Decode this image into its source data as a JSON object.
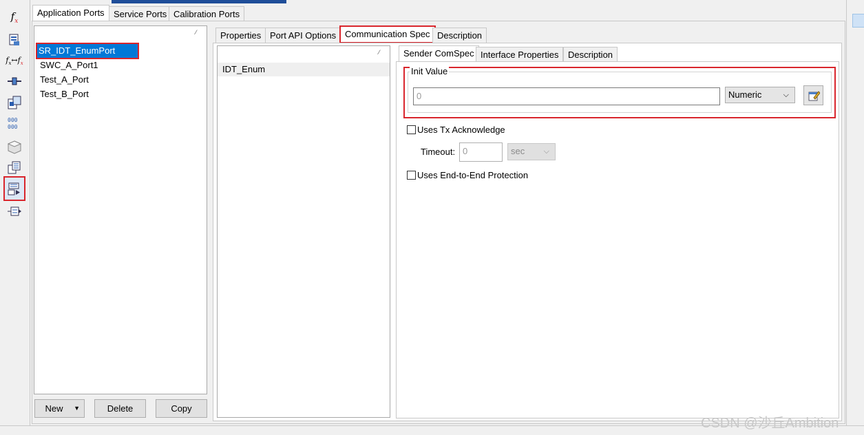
{
  "outer_tabs": [
    "Application Ports",
    "Service Ports",
    "Calibration Ports"
  ],
  "port_list": {
    "sort_mark": "⁄",
    "items": [
      "SR_IDT_EnumPort",
      "SWC_A_Port1",
      "Test_A_Port",
      "Test_B_Port"
    ],
    "selected_index": 0
  },
  "port_buttons": {
    "new": "New",
    "delete": "Delete",
    "copy": "Copy"
  },
  "detail_tabs": [
    "Properties",
    "Port API Options",
    "Communication Spec",
    "Description"
  ],
  "element_list": {
    "sort_mark": "⁄",
    "items": [
      "IDT_Enum"
    ]
  },
  "comspec_tabs": [
    "Sender ComSpec",
    "Interface Properties",
    "Description"
  ],
  "init_value": {
    "title": "Init Value",
    "value": "0",
    "type": "Numeric"
  },
  "tx_ack": {
    "label": "Uses Tx Acknowledge",
    "checked": false,
    "timeout_label": "Timeout:",
    "timeout_value": "0",
    "timeout_unit": "sec"
  },
  "e2e": {
    "label": "Uses End-to-End Protection",
    "checked": false
  },
  "toolbar_icons": [
    "function-icon",
    "document-list-icon",
    "function-mapping-icon",
    "connector-icon",
    "component-icon",
    "runnable-icon",
    "package-icon",
    "port-list-icon",
    "port-interface-icon",
    "port-prototype-icon"
  ],
  "watermark": "CSDN @沙丘Ambition",
  "colors": {
    "selection": "#0078d7",
    "highlight_frame": "#d9252c",
    "accent_bar": "#1f4e99"
  }
}
